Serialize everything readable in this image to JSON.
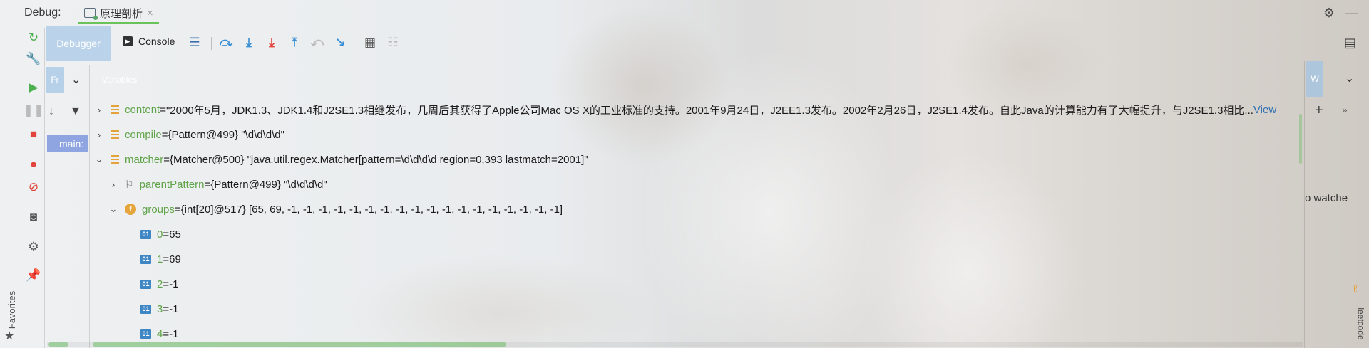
{
  "header": {
    "title": "Debug:",
    "session_tab": "原理剖析",
    "close_glyph": "×",
    "settings_icon": "gear-icon",
    "minimize_icon": "minimize-icon"
  },
  "toolbar": {
    "debugger_tab": "Debugger",
    "console_tab": "Console",
    "icons": [
      "menu-icon",
      "step-over-icon",
      "step-into-icon",
      "force-step-into-icon",
      "step-out-icon",
      "drop-frame-icon",
      "run-to-cursor-icon",
      "evaluate-icon",
      "trace-icon"
    ]
  },
  "left_bar": {
    "icons": [
      "rerun-icon",
      "wrench-icon",
      "resume-icon",
      "pause-icon",
      "stop-icon",
      "breakpoints-icon",
      "mute-breakpoints-icon",
      "camera-icon",
      "settings-icon",
      "pin-icon"
    ],
    "favorites_label": "Favorites"
  },
  "frames": {
    "tab_label": "Fr",
    "selected_frame": "main:"
  },
  "variables": {
    "header_label": "Variables",
    "rows": [
      {
        "level": 0,
        "arrow": "›",
        "icon": "list",
        "name": "content",
        "eq": " = ",
        "value": "\"2000年5月，JDK1.3、JDK1.4和J2SE1.3相继发布，几周后其获得了Apple公司Mac OS X的工业标准的支持。2001年9月24日，J2EE1.3发布。2002年2月26日，J2SE1.4发布。自此Java的计算能力有了大幅提升，与J2SE1.3相比... ",
        "link": "View"
      },
      {
        "level": 0,
        "arrow": "›",
        "icon": "list",
        "name": "compile",
        "eq": " = ",
        "value": "{Pattern@499} \"\\d\\d\\d\\d\""
      },
      {
        "level": 0,
        "arrow": "⌄",
        "icon": "list",
        "name": "matcher",
        "eq": " = ",
        "value": "{Matcher@500} \"java.util.regex.Matcher[pattern=\\d\\d\\d\\d region=0,393 lastmatch=2001]\""
      },
      {
        "level": 1,
        "arrow": "›",
        "icon": "flag",
        "name": "parentPattern",
        "eq": " = ",
        "value": "{Pattern@499} \"\\d\\d\\d\\d\""
      },
      {
        "level": 1,
        "arrow": "⌄",
        "icon": "f",
        "name": "groups",
        "eq": " = ",
        "value": "{int[20]@517} [65, 69, -1, -1, -1, -1, -1, -1, -1, -1, -1, -1, -1, -1, -1, -1, -1, -1, -1, -1]"
      },
      {
        "level": 2,
        "arrow": "",
        "icon": "01",
        "name": "0",
        "eq": " = ",
        "value": "65"
      },
      {
        "level": 2,
        "arrow": "",
        "icon": "01",
        "name": "1",
        "eq": " = ",
        "value": "69"
      },
      {
        "level": 2,
        "arrow": "",
        "icon": "01",
        "name": "2",
        "eq": " = ",
        "value": "-1"
      },
      {
        "level": 2,
        "arrow": "",
        "icon": "01",
        "name": "3",
        "eq": " = ",
        "value": "-1"
      },
      {
        "level": 2,
        "arrow": "",
        "icon": "01",
        "name": "4",
        "eq": " = ",
        "value": "-1"
      }
    ]
  },
  "watches": {
    "tab_label": "W",
    "add_glyph": "+",
    "more_glyph": "»",
    "empty_text": "o watche"
  },
  "right_strip": {
    "leetcode_label": "leetcode"
  },
  "colors": {
    "accent_tab": "#a0c3e6",
    "selected_frame": "#6e8cdc",
    "var_name": "#5fa348",
    "link": "#2f6fb3"
  }
}
